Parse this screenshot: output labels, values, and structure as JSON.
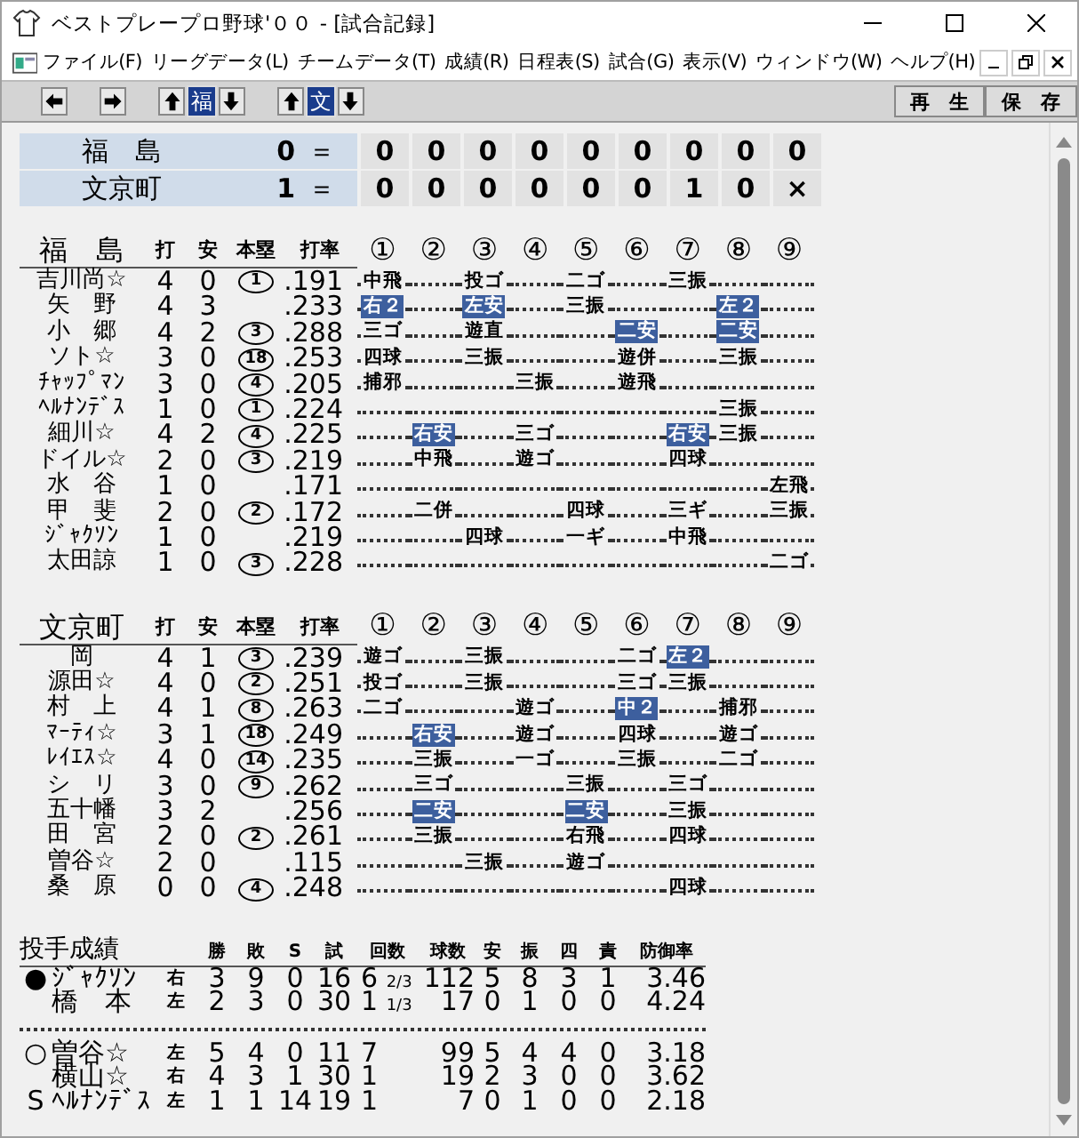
{
  "window": {
    "title": "ベストプレープロ野球'００ - [試合記録]"
  },
  "menu": [
    "ファイル(F)",
    "リーグデータ(L)",
    "チームデータ(T)",
    "成績(R)",
    "日程表(S)",
    "試合(G)",
    "表示(V)",
    "ウィンドウ(W)",
    "ヘルプ(H)"
  ],
  "toolbar": {
    "team_buttons": [
      {
        "label": "福",
        "selected": true
      },
      {
        "label": "文",
        "selected": true
      }
    ],
    "buttons": [
      "再　生",
      "保　存"
    ]
  },
  "line_score": [
    {
      "team": "福　島",
      "total": "0",
      "equals": "＝",
      "innings": [
        "0",
        "0",
        "0",
        "0",
        "0",
        "0",
        "0",
        "0",
        "0"
      ]
    },
    {
      "team": "文京町",
      "total": "1",
      "equals": "＝",
      "innings": [
        "0",
        "0",
        "0",
        "0",
        "0",
        "0",
        "1",
        "0",
        "×"
      ]
    }
  ],
  "batting": [
    {
      "team": "福　島",
      "columns": [
        "打",
        "安",
        "本塁",
        "打率"
      ],
      "inning_headers": [
        "①",
        "②",
        "③",
        "④",
        "⑤",
        "⑥",
        "⑦",
        "⑧",
        "⑨"
      ],
      "batters": [
        {
          "name": "吉川尚☆",
          "ab": "4",
          "h": "0",
          "hr": "1",
          "avg": ".191",
          "results": [
            {
              "kind": "out",
              "text": "中飛"
            },
            {
              "kind": "none"
            },
            {
              "kind": "out",
              "text": "投ゴ"
            },
            {
              "kind": "none"
            },
            {
              "kind": "out",
              "text": "二ゴ"
            },
            {
              "kind": "none"
            },
            {
              "kind": "out",
              "text": "三振"
            },
            {
              "kind": "none"
            },
            {
              "kind": "none"
            }
          ]
        },
        {
          "name": "矢　野",
          "ab": "4",
          "h": "3",
          "avg": ".233",
          "results": [
            {
              "kind": "hit",
              "text": "右２"
            },
            {
              "kind": "none"
            },
            {
              "kind": "hit",
              "text": "左安"
            },
            {
              "kind": "none"
            },
            {
              "kind": "out",
              "text": "三振"
            },
            {
              "kind": "none"
            },
            {
              "kind": "none"
            },
            {
              "kind": "hit",
              "text": "左２"
            },
            {
              "kind": "none"
            }
          ]
        },
        {
          "name": "小　郷",
          "ab": "4",
          "h": "2",
          "hr": "3",
          "avg": ".288",
          "results": [
            {
              "kind": "out",
              "text": "三ゴ"
            },
            {
              "kind": "none"
            },
            {
              "kind": "out",
              "text": "遊直"
            },
            {
              "kind": "none"
            },
            {
              "kind": "none"
            },
            {
              "kind": "hit",
              "text": "二安"
            },
            {
              "kind": "none"
            },
            {
              "kind": "hit",
              "text": "二安"
            },
            {
              "kind": "none"
            }
          ]
        },
        {
          "name": "ソト☆",
          "ab": "3",
          "h": "0",
          "hr": "18",
          "avg": ".253",
          "results": [
            {
              "kind": "out",
              "text": "四球"
            },
            {
              "kind": "none"
            },
            {
              "kind": "out",
              "text": "三振"
            },
            {
              "kind": "none"
            },
            {
              "kind": "none"
            },
            {
              "kind": "out",
              "text": "遊併"
            },
            {
              "kind": "none"
            },
            {
              "kind": "out",
              "text": "三振"
            },
            {
              "kind": "none"
            }
          ]
        },
        {
          "name": "ﾁｬｯﾌﾟﾏﾝ",
          "ab": "3",
          "h": "0",
          "hr": "4",
          "avg": ".205",
          "results": [
            {
              "kind": "out",
              "text": "捕邪"
            },
            {
              "kind": "none"
            },
            {
              "kind": "none"
            },
            {
              "kind": "out",
              "text": "三振"
            },
            {
              "kind": "none"
            },
            {
              "kind": "out",
              "text": "遊飛"
            },
            {
              "kind": "none"
            },
            {
              "kind": "none"
            },
            {
              "kind": "none"
            }
          ]
        },
        {
          "name": "ﾍﾙﾅﾝﾃﾞｽ",
          "ab": "1",
          "h": "0",
          "hr": "1",
          "avg": ".224",
          "results": [
            {
              "kind": "none"
            },
            {
              "kind": "none"
            },
            {
              "kind": "none"
            },
            {
              "kind": "none"
            },
            {
              "kind": "none"
            },
            {
              "kind": "none"
            },
            {
              "kind": "none"
            },
            {
              "kind": "out",
              "text": "三振"
            },
            {
              "kind": "none"
            }
          ]
        },
        {
          "name": "細川☆",
          "ab": "4",
          "h": "2",
          "hr": "4",
          "avg": ".225",
          "results": [
            {
              "kind": "none"
            },
            {
              "kind": "hit",
              "text": "右安"
            },
            {
              "kind": "none"
            },
            {
              "kind": "out",
              "text": "三ゴ"
            },
            {
              "kind": "none"
            },
            {
              "kind": "none"
            },
            {
              "kind": "hit",
              "text": "右安"
            },
            {
              "kind": "out",
              "text": "三振"
            },
            {
              "kind": "none"
            }
          ]
        },
        {
          "name": "ドイル☆",
          "ab": "2",
          "h": "0",
          "hr": "3",
          "avg": ".219",
          "results": [
            {
              "kind": "none"
            },
            {
              "kind": "out",
              "text": "中飛"
            },
            {
              "kind": "none"
            },
            {
              "kind": "out",
              "text": "遊ゴ"
            },
            {
              "kind": "none"
            },
            {
              "kind": "none"
            },
            {
              "kind": "out",
              "text": "四球"
            },
            {
              "kind": "none"
            },
            {
              "kind": "none"
            }
          ]
        },
        {
          "name": "水　谷",
          "ab": "1",
          "h": "0",
          "avg": ".171",
          "results": [
            {
              "kind": "none"
            },
            {
              "kind": "none"
            },
            {
              "kind": "none"
            },
            {
              "kind": "none"
            },
            {
              "kind": "none"
            },
            {
              "kind": "none"
            },
            {
              "kind": "none"
            },
            {
              "kind": "none"
            },
            {
              "kind": "out",
              "text": "左飛"
            }
          ]
        },
        {
          "name": "甲　斐",
          "ab": "2",
          "h": "0",
          "hr": "2",
          "avg": ".172",
          "results": [
            {
              "kind": "none"
            },
            {
              "kind": "out",
              "text": "二併"
            },
            {
              "kind": "none"
            },
            {
              "kind": "none"
            },
            {
              "kind": "out",
              "text": "四球"
            },
            {
              "kind": "none"
            },
            {
              "kind": "out",
              "text": "三ギ"
            },
            {
              "kind": "none"
            },
            {
              "kind": "out",
              "text": "三振"
            }
          ]
        },
        {
          "name": "ｼﾞｬｸｿﾝ",
          "ab": "1",
          "h": "0",
          "avg": ".219",
          "results": [
            {
              "kind": "none"
            },
            {
              "kind": "none"
            },
            {
              "kind": "out",
              "text": "四球"
            },
            {
              "kind": "none"
            },
            {
              "kind": "out",
              "text": "一ギ"
            },
            {
              "kind": "none"
            },
            {
              "kind": "out",
              "text": "中飛"
            },
            {
              "kind": "none"
            },
            {
              "kind": "none"
            }
          ]
        },
        {
          "name": "太田諒",
          "ab": "1",
          "h": "0",
          "hr": "3",
          "avg": ".228",
          "results": [
            {
              "kind": "none"
            },
            {
              "kind": "none"
            },
            {
              "kind": "none"
            },
            {
              "kind": "none"
            },
            {
              "kind": "none"
            },
            {
              "kind": "none"
            },
            {
              "kind": "none"
            },
            {
              "kind": "none"
            },
            {
              "kind": "out",
              "text": "二ゴ"
            }
          ]
        }
      ]
    },
    {
      "team": "文京町",
      "columns": [
        "打",
        "安",
        "本塁",
        "打率"
      ],
      "inning_headers": [
        "①",
        "②",
        "③",
        "④",
        "⑤",
        "⑥",
        "⑦",
        "⑧",
        "⑨"
      ],
      "batters": [
        {
          "name": "岡",
          "ab": "4",
          "h": "1",
          "hr": "3",
          "avg": ".239",
          "results": [
            {
              "kind": "out",
              "text": "遊ゴ"
            },
            {
              "kind": "none"
            },
            {
              "kind": "out",
              "text": "三振"
            },
            {
              "kind": "none"
            },
            {
              "kind": "none"
            },
            {
              "kind": "out",
              "text": "二ゴ"
            },
            {
              "kind": "hit",
              "text": "左２"
            },
            {
              "kind": "none"
            },
            {
              "kind": "none"
            }
          ]
        },
        {
          "name": "源田☆",
          "ab": "4",
          "h": "0",
          "hr": "2",
          "avg": ".251",
          "results": [
            {
              "kind": "out",
              "text": "投ゴ"
            },
            {
              "kind": "none"
            },
            {
              "kind": "out",
              "text": "三振"
            },
            {
              "kind": "none"
            },
            {
              "kind": "none"
            },
            {
              "kind": "out",
              "text": "三ゴ"
            },
            {
              "kind": "out",
              "text": "三振"
            },
            {
              "kind": "none"
            },
            {
              "kind": "none"
            }
          ]
        },
        {
          "name": "村　上",
          "ab": "4",
          "h": "1",
          "hr": "8",
          "avg": ".263",
          "results": [
            {
              "kind": "out",
              "text": "二ゴ"
            },
            {
              "kind": "none"
            },
            {
              "kind": "none"
            },
            {
              "kind": "out",
              "text": "遊ゴ"
            },
            {
              "kind": "none"
            },
            {
              "kind": "hit",
              "text": "中２"
            },
            {
              "kind": "none"
            },
            {
              "kind": "out",
              "text": "捕邪"
            },
            {
              "kind": "none"
            }
          ]
        },
        {
          "name": "ﾏｰﾃｨ☆",
          "ab": "3",
          "h": "1",
          "hr": "18",
          "avg": ".249",
          "results": [
            {
              "kind": "none"
            },
            {
              "kind": "hit",
              "text": "右安"
            },
            {
              "kind": "none"
            },
            {
              "kind": "out",
              "text": "遊ゴ"
            },
            {
              "kind": "none"
            },
            {
              "kind": "out",
              "text": "四球"
            },
            {
              "kind": "none"
            },
            {
              "kind": "out",
              "text": "遊ゴ"
            },
            {
              "kind": "none"
            }
          ]
        },
        {
          "name": "ﾚｲｴｽ☆",
          "ab": "4",
          "h": "0",
          "hr": "14",
          "avg": ".235",
          "results": [
            {
              "kind": "none"
            },
            {
              "kind": "out",
              "text": "三振"
            },
            {
              "kind": "none"
            },
            {
              "kind": "out",
              "text": "一ゴ"
            },
            {
              "kind": "none"
            },
            {
              "kind": "out",
              "text": "三振"
            },
            {
              "kind": "none"
            },
            {
              "kind": "out",
              "text": "二ゴ"
            },
            {
              "kind": "none"
            }
          ]
        },
        {
          "name": "シ　リ",
          "ab": "3",
          "h": "0",
          "hr": "9",
          "avg": ".262",
          "results": [
            {
              "kind": "none"
            },
            {
              "kind": "out",
              "text": "三ゴ"
            },
            {
              "kind": "none"
            },
            {
              "kind": "none"
            },
            {
              "kind": "out",
              "text": "三振"
            },
            {
              "kind": "none"
            },
            {
              "kind": "out",
              "text": "三ゴ"
            },
            {
              "kind": "none"
            },
            {
              "kind": "none"
            }
          ]
        },
        {
          "name": "五十幡",
          "ab": "3",
          "h": "2",
          "avg": ".256",
          "results": [
            {
              "kind": "none"
            },
            {
              "kind": "hit",
              "text": "二安"
            },
            {
              "kind": "none"
            },
            {
              "kind": "none"
            },
            {
              "kind": "hit",
              "text": "二安"
            },
            {
              "kind": "none"
            },
            {
              "kind": "out",
              "text": "三振"
            },
            {
              "kind": "none"
            },
            {
              "kind": "none"
            }
          ]
        },
        {
          "name": "田　宮",
          "ab": "2",
          "h": "0",
          "hr": "2",
          "avg": ".261",
          "results": [
            {
              "kind": "none"
            },
            {
              "kind": "out",
              "text": "三振"
            },
            {
              "kind": "none"
            },
            {
              "kind": "none"
            },
            {
              "kind": "out",
              "text": "右飛"
            },
            {
              "kind": "none"
            },
            {
              "kind": "out",
              "text": "四球"
            },
            {
              "kind": "none"
            },
            {
              "kind": "none"
            }
          ]
        },
        {
          "name": "曽谷☆",
          "ab": "2",
          "h": "0",
          "avg": ".115",
          "results": [
            {
              "kind": "none"
            },
            {
              "kind": "none"
            },
            {
              "kind": "out",
              "text": "三振"
            },
            {
              "kind": "none"
            },
            {
              "kind": "out",
              "text": "遊ゴ"
            },
            {
              "kind": "none"
            },
            {
              "kind": "none"
            },
            {
              "kind": "none"
            },
            {
              "kind": "none"
            }
          ]
        },
        {
          "name": "桑　原",
          "ab": "0",
          "h": "0",
          "hr": "4",
          "avg": ".248",
          "results": [
            {
              "kind": "none"
            },
            {
              "kind": "none"
            },
            {
              "kind": "none"
            },
            {
              "kind": "none"
            },
            {
              "kind": "none"
            },
            {
              "kind": "none"
            },
            {
              "kind": "out",
              "text": "四球"
            },
            {
              "kind": "none"
            },
            {
              "kind": "none"
            }
          ]
        }
      ]
    }
  ],
  "pitching": {
    "title": "投手成績",
    "columns": [
      "勝",
      "敗",
      "S",
      "試",
      "回数",
      "球数",
      "安",
      "振",
      "四",
      "責",
      "防御率"
    ],
    "groups": [
      [
        {
          "mark": "●",
          "name": "ｼﾞｬｸｿﾝ",
          "hand": "右",
          "stats": [
            "3",
            "9",
            "0",
            "16"
          ],
          "innings": "6",
          "innings_fraction": "2/3",
          "rest": [
            "112",
            "5",
            "8",
            "3",
            "1",
            "3.46"
          ]
        },
        {
          "name": "橋　本",
          "hand": "左",
          "stats": [
            "2",
            "3",
            "0",
            "30"
          ],
          "innings": "1",
          "innings_fraction": "1/3",
          "rest": [
            "17",
            "0",
            "1",
            "0",
            "0",
            "4.24"
          ]
        }
      ],
      [
        {
          "mark": "○",
          "name": "曽谷☆",
          "hand": "左",
          "stats": [
            "5",
            "4",
            "0",
            "11"
          ],
          "innings": "7",
          "rest": [
            "99",
            "5",
            "4",
            "4",
            "0",
            "3.18"
          ]
        },
        {
          "name": "横山☆",
          "hand": "右",
          "stats": [
            "4",
            "3",
            "1",
            "30"
          ],
          "innings": "1",
          "rest": [
            "19",
            "2",
            "3",
            "0",
            "0",
            "3.62"
          ]
        },
        {
          "mark": "S",
          "name": "ﾍﾙﾅﾝﾃﾞｽ",
          "hand": "左",
          "stats": [
            "1",
            "1",
            "14",
            "19"
          ],
          "innings": "1",
          "rest": [
            "7",
            "0",
            "1",
            "0",
            "0",
            "2.18"
          ]
        }
      ]
    ]
  }
}
